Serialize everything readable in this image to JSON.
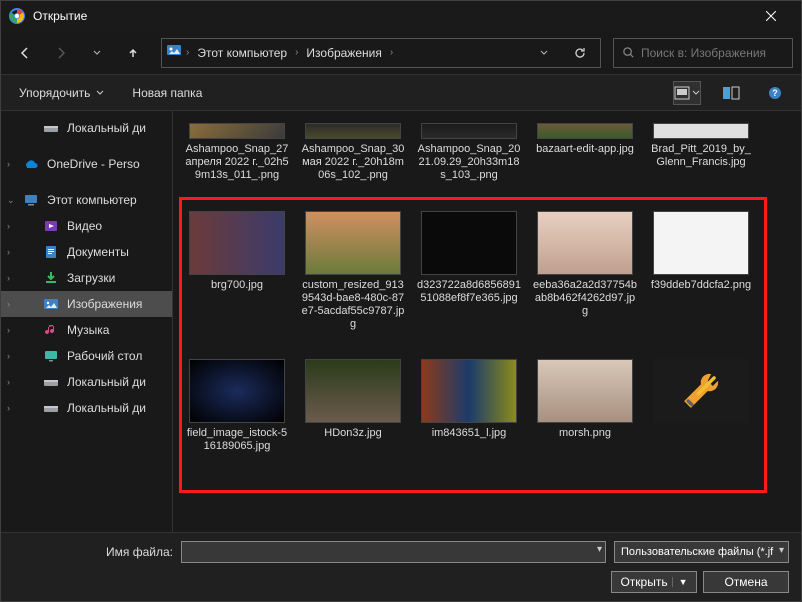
{
  "titlebar": {
    "title": "Открытие"
  },
  "nav": {
    "path": [
      "Этот компьютер",
      "Изображения"
    ],
    "search_placeholder": "Поиск в: Изображения"
  },
  "toolbar": {
    "organize": "Упорядочить",
    "new_folder": "Новая папка"
  },
  "sidebar": {
    "items": [
      {
        "label": "Локальный ди",
        "type": "drive",
        "indent": 1
      },
      {
        "label": "OneDrive - Perso",
        "type": "onedrive",
        "indent": 0,
        "expandable": true
      },
      {
        "label": "Этот компьютер",
        "type": "pc",
        "indent": 0,
        "expandable": true,
        "expanded": true
      },
      {
        "label": "Видео",
        "type": "video",
        "indent": 1,
        "expandable": true
      },
      {
        "label": "Документы",
        "type": "docs",
        "indent": 1,
        "expandable": true
      },
      {
        "label": "Загрузки",
        "type": "downloads",
        "indent": 1,
        "expandable": true
      },
      {
        "label": "Изображения",
        "type": "pictures",
        "indent": 1,
        "expandable": true,
        "selected": true
      },
      {
        "label": "Музыка",
        "type": "music",
        "indent": 1,
        "expandable": true
      },
      {
        "label": "Рабочий стол",
        "type": "desktop",
        "indent": 1,
        "expandable": true
      },
      {
        "label": "Локальный ди",
        "type": "drive",
        "indent": 1,
        "expandable": true
      },
      {
        "label": "Локальный ди",
        "type": "drive",
        "indent": 1,
        "expandable": true
      }
    ]
  },
  "files": {
    "row1": [
      {
        "name": "Ashampoo_Snap_27 апреля 2022 г._02h59m13s_011_.png",
        "th": "th-a"
      },
      {
        "name": "Ashampoo_Snap_30 мая 2022 г._20h18m06s_102_.png",
        "th": "th-b"
      },
      {
        "name": "Ashampoo_Snap_2021.09.29_20h33m18s_103_.png",
        "th": "th-c"
      },
      {
        "name": "bazaart-edit-app.jpg",
        "th": "th-d"
      },
      {
        "name": "Brad_Pitt_2019_by_Glenn_Francis.jpg",
        "th": "th-e"
      }
    ],
    "row2": [
      {
        "name": "brg700.jpg",
        "th": "th-f"
      },
      {
        "name": "custom_resized_9139543d-bae8-480c-87e7-5acdaf55c9787.jpg",
        "th": "th-g"
      },
      {
        "name": "d323722a8d685689151088ef8f7e365.jpg",
        "th": "th-h"
      },
      {
        "name": "eeba36a2a2d37754bab8b462f4262d97.jpg",
        "th": "th-i"
      },
      {
        "name": "f39ddeb7ddcfa2.png",
        "th": "th-j"
      }
    ],
    "row3": [
      {
        "name": "field_image_istock-516189065.jpg",
        "th": "th-k"
      },
      {
        "name": "HDon3z.jpg",
        "th": "th-l"
      },
      {
        "name": "im843651_l.jpg",
        "th": "th-m"
      },
      {
        "name": "morsh.png",
        "th": "th-n"
      },
      {
        "name": "",
        "th": "th-o",
        "tools": true
      }
    ]
  },
  "bottom": {
    "fname_label": "Имя файла:",
    "fname_value": "",
    "filter": "Пользовательские файлы (*.jf",
    "open": "Открыть",
    "cancel": "Отмена"
  }
}
